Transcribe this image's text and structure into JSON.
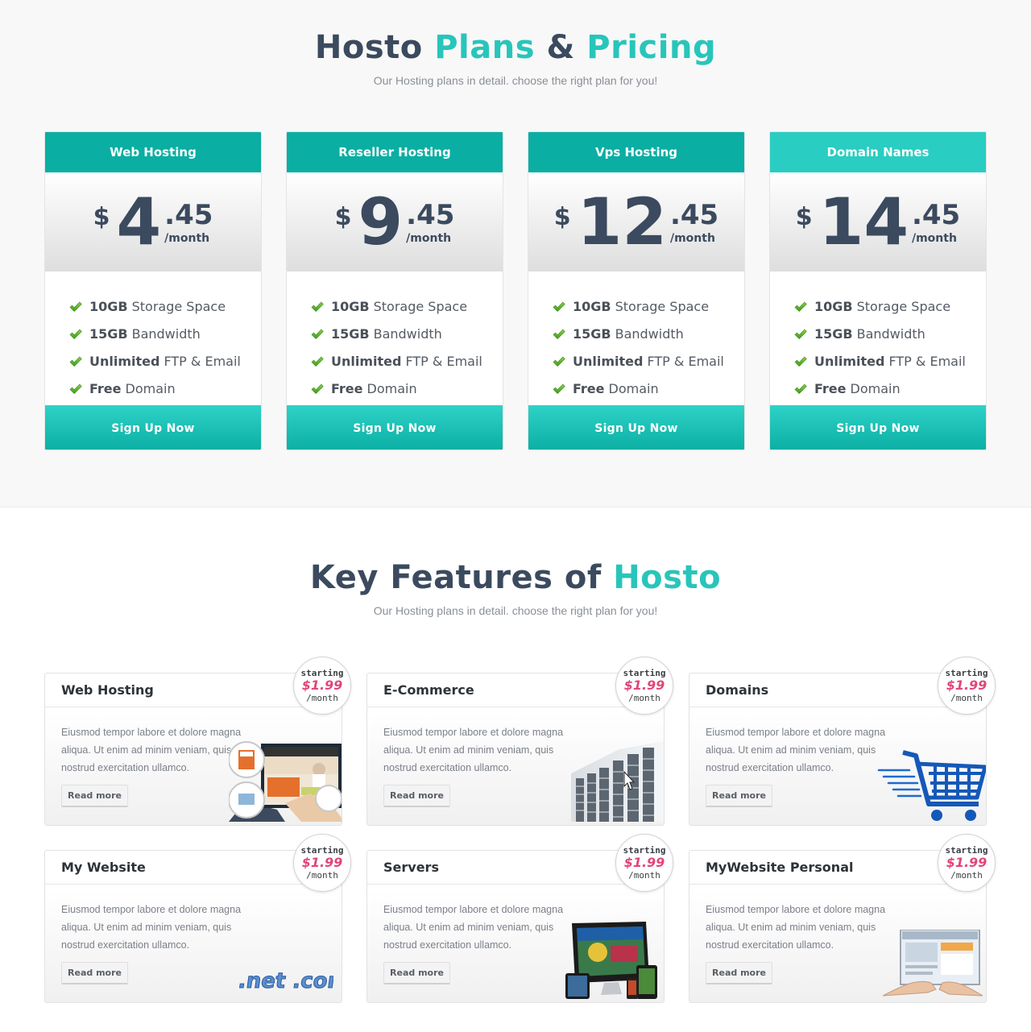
{
  "pricing": {
    "title_parts": [
      "Hosto",
      "Plans",
      "&",
      "Pricing"
    ],
    "subtitle": "Our Hosting plans in detail. choose the right plan for you!",
    "plans": [
      {
        "name": "Web Hosting",
        "currency": "$",
        "amount": "4",
        "cents": ".45",
        "period": "/month",
        "signup": "Sign Up Now"
      },
      {
        "name": "Reseller Hosting",
        "currency": "$",
        "amount": "9",
        "cents": ".45",
        "period": "/month",
        "signup": "Sign Up Now"
      },
      {
        "name": "Vps Hosting",
        "currency": "$",
        "amount": "12",
        "cents": ".45",
        "period": "/month",
        "signup": "Sign Up Now"
      },
      {
        "name": "Domain Names",
        "currency": "$",
        "amount": "14",
        "cents": ".45",
        "period": "/month",
        "signup": "Sign Up Now"
      }
    ],
    "features": [
      {
        "bold": "10GB",
        "text": "Storage Space"
      },
      {
        "bold": "15GB",
        "text": "Bandwidth"
      },
      {
        "bold": "Unlimited",
        "text": "FTP & Email"
      },
      {
        "bold": "Free",
        "text": "Domain"
      }
    ],
    "check_icon": "checkmark-icon",
    "accent": "#0aaea3",
    "accent_light": "#29cdc1"
  },
  "key_features": {
    "title_parts": [
      "Key Features of",
      "Hosto"
    ],
    "subtitle": "Our Hosting plans in detail. choose the right plan for you!",
    "badge": {
      "starting": "starting",
      "price": "$1.99",
      "period": "/month"
    },
    "description": "Eiusmod tempor labore et dolore magna aliqua. Ut enim ad minim veniam, quis nostrud exercitation ullamco.",
    "read_more": "Read more",
    "cards": [
      {
        "title": "Web Hosting",
        "art": "website-design-illustration"
      },
      {
        "title": "E-Commerce",
        "art": "server-rack-illustration"
      },
      {
        "title": "Domains",
        "art": "shopping-cart-icon"
      },
      {
        "title": "My Website",
        "art": "dotcom-illustration",
        "art_text": ".net .com"
      },
      {
        "title": "Servers",
        "art": "devices-illustration"
      },
      {
        "title": "MyWebsite Personal",
        "art": "hands-website-illustration"
      }
    ],
    "price_color": "#e2457a"
  }
}
